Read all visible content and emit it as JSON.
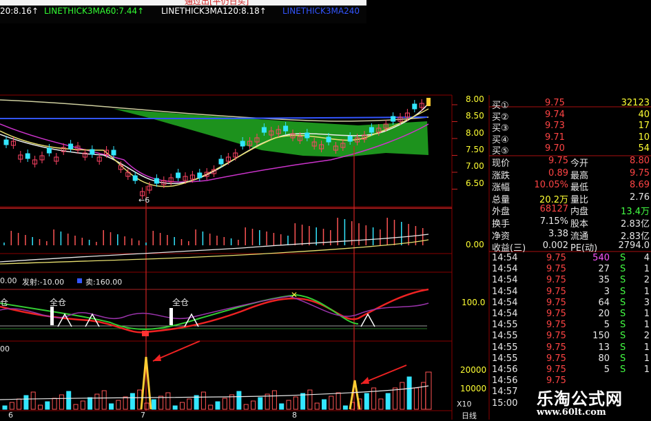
{
  "header": {
    "title_partial": "通过出[平仍日买]",
    "indicators": [
      {
        "label": "20:8.16↑",
        "color": "#ffffff"
      },
      {
        "label": "LINETHICK3MA60:7.44↑",
        "color": "#33ff33"
      },
      {
        "label": "LINETHICK3MA120:8.18↑",
        "color": "#ffffff"
      },
      {
        "label": "LINETHICK3MA240",
        "color": "#3355ff"
      }
    ]
  },
  "price_axis": [
    "8.00",
    "8.50",
    "8.00",
    "7.50",
    "7.00",
    "6.50"
  ],
  "volume_axis": [
    "0.00"
  ],
  "signal_axis": [
    "100.0"
  ],
  "bottom_axis": [
    "20000",
    "10000",
    "X10"
  ],
  "annotations": {
    "low_marker": "←6",
    "signal_header_left": "0.00",
    "signal_fire_label": "发射:-10.00",
    "signal_sell_label": "卖:160.00",
    "all_position_1": "仓",
    "all_position_2": "全仓",
    "all_position_3": "全仓",
    "bottom_left": "00"
  },
  "x_axis": {
    "ticks": [
      "6",
      "7",
      "8"
    ],
    "period": "日线"
  },
  "order_book": [
    {
      "label": "买①",
      "price": "9.75",
      "qty": "32123"
    },
    {
      "label": "买②",
      "price": "9.74",
      "qty": "40"
    },
    {
      "label": "买③",
      "price": "9.73",
      "qty": "17"
    },
    {
      "label": "买④",
      "price": "9.71",
      "qty": "10"
    },
    {
      "label": "买⑤",
      "price": "9.70",
      "qty": "54"
    }
  ],
  "quote": [
    {
      "l1": "现价",
      "v1": "9.75",
      "l2": "今开",
      "v2": "8.80"
    },
    {
      "l1": "涨跌",
      "v1": "0.89",
      "l2": "最高",
      "v2": "9.75"
    },
    {
      "l1": "涨幅",
      "v1": "10.05%",
      "l2": "最低",
      "v2": "8.69"
    },
    {
      "l1": "总量",
      "v1": "20.2万",
      "l2": "量比",
      "v2": "2.76"
    },
    {
      "l1": "外盘",
      "v1": "68127",
      "l2": "内盘",
      "v2": "13.4万"
    },
    {
      "l1": "换手",
      "v1": "7.15%",
      "l2": "股本",
      "v2": "2.83亿"
    },
    {
      "l1": "净资",
      "v1": "3.38",
      "l2": "流通",
      "v2": "2.83亿"
    },
    {
      "l1": "收益(三)",
      "v1": "0.002",
      "l2": "PE(动)",
      "v2": "2794.0"
    }
  ],
  "ticks": [
    {
      "time": "14:54",
      "price": "9.75",
      "vol": "540",
      "side": "S",
      "n": "4"
    },
    {
      "time": "14:54",
      "price": "9.75",
      "vol": "27",
      "side": "S",
      "n": "1"
    },
    {
      "time": "14:54",
      "price": "9.75",
      "vol": "35",
      "side": "S",
      "n": "2"
    },
    {
      "time": "14:54",
      "price": "9.75",
      "vol": "3",
      "side": "S",
      "n": "1"
    },
    {
      "time": "14:54",
      "price": "9.75",
      "vol": "64",
      "side": "S",
      "n": "3"
    },
    {
      "time": "14:54",
      "price": "9.75",
      "vol": "20",
      "side": "S",
      "n": "1"
    },
    {
      "time": "14:55",
      "price": "9.75",
      "vol": "5",
      "side": "S",
      "n": "1"
    },
    {
      "time": "14:55",
      "price": "9.75",
      "vol": "150",
      "side": "S",
      "n": "2"
    },
    {
      "time": "14:55",
      "price": "9.75",
      "vol": "13",
      "side": "S",
      "n": "1"
    },
    {
      "time": "14:55",
      "price": "9.75",
      "vol": "80",
      "side": "S",
      "n": "1"
    },
    {
      "time": "14:56",
      "price": "9.75",
      "vol": "5",
      "side": "S",
      "n": "1"
    },
    {
      "time": "14:56",
      "price": "9.75",
      "vol": "",
      "side": "",
      "n": ""
    },
    {
      "time": "14:57",
      "price": "",
      "vol": "",
      "side": "",
      "n": ""
    },
    {
      "time": "15:00",
      "price": "",
      "vol": "",
      "side": "",
      "n": ""
    }
  ],
  "watermark": {
    "name": "乐淘公式网",
    "url": "www.60lt.com"
  },
  "colors": {
    "up": "#ff3333",
    "down": "#33ffff",
    "grid": "#8a0000",
    "cloud": "#1f9a1f"
  }
}
